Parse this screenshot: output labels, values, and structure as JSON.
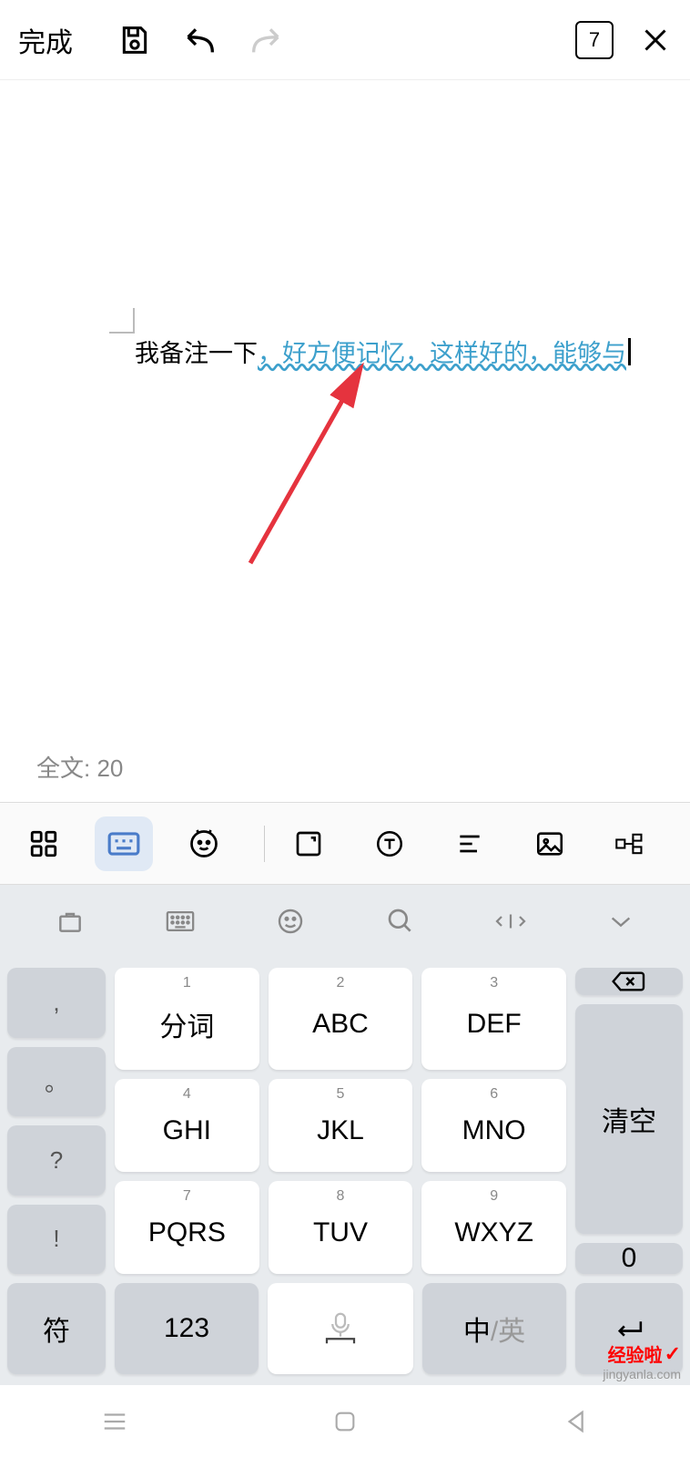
{
  "top_toolbar": {
    "done_label": "完成",
    "page_number": "7"
  },
  "document": {
    "text_normal": "我备注一下",
    "text_highlight": "，好方便记忆，这样好的，能够与",
    "word_count": "全文: 20"
  },
  "keyboard": {
    "side_left": [
      ",",
      "。",
      "?",
      "!"
    ],
    "keys": [
      {
        "sup": "1",
        "main": "分词"
      },
      {
        "sup": "2",
        "main": "ABC"
      },
      {
        "sup": "3",
        "main": "DEF"
      },
      {
        "sup": "4",
        "main": "GHI"
      },
      {
        "sup": "5",
        "main": "JKL"
      },
      {
        "sup": "6",
        "main": "MNO"
      },
      {
        "sup": "7",
        "main": "PQRS"
      },
      {
        "sup": "8",
        "main": "TUV"
      },
      {
        "sup": "9",
        "main": "WXYZ"
      }
    ],
    "right": {
      "backspace": "⌫",
      "clear": "清空",
      "zero": "0"
    },
    "bottom": {
      "symbol": "符",
      "numeric": "123",
      "lang_active": "中",
      "lang_inactive": "/英"
    }
  },
  "watermark": {
    "brand": "经验啦",
    "url": "jingyanla.com"
  }
}
